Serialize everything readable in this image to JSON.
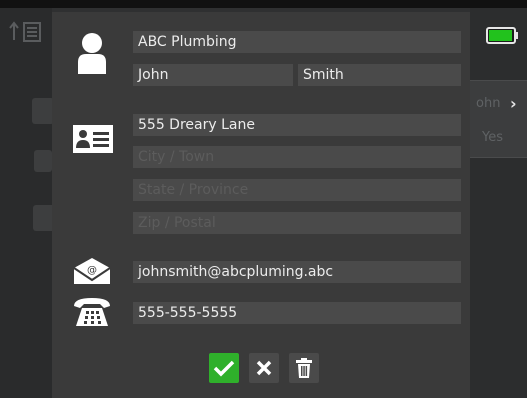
{
  "background": {
    "right_panel": {
      "line1": "ohn",
      "line2": "Yes"
    },
    "chevron": "›"
  },
  "contact": {
    "company": "ABC Plumbing",
    "first_name": "John",
    "last_name": "Smith",
    "street": "555 Dreary Lane",
    "city_placeholder": "City / Town",
    "state_placeholder": "State / Province",
    "zip_placeholder": "Zip / Postal",
    "email": "johnsmith@abcpluming.abc",
    "phone": "555-555-5555"
  },
  "icons": {
    "person": "person-icon",
    "address_card": "address-card-icon",
    "email": "email-icon",
    "phone": "telephone-icon",
    "battery": "battery-icon",
    "confirm": "check-icon",
    "cancel": "close-icon",
    "delete": "trash-icon"
  },
  "colors": {
    "dialog_bg": "#3a3a3a",
    "field_bg": "#4a4a4a",
    "confirm_green": "#2fb02b",
    "battery_green": "#22c21d"
  }
}
